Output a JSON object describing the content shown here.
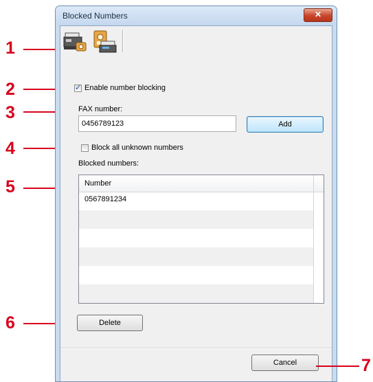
{
  "window": {
    "title": "Blocked Numbers",
    "close_label": "✕"
  },
  "toolbar": {
    "items": [
      {
        "icon": "fax-machine-icon"
      },
      {
        "icon": "fax-phonebook-icon"
      }
    ]
  },
  "enable_blocking": {
    "label": "Enable number blocking",
    "checked": true
  },
  "fax_number": {
    "label": "FAX number:",
    "value": "0456789123"
  },
  "add_button": {
    "label": "Add"
  },
  "block_unknown": {
    "label": "Block all unknown numbers",
    "checked": false
  },
  "blocked_numbers": {
    "label": "Blocked numbers:",
    "column_header": "Number",
    "rows": [
      "0567891234",
      "",
      "",
      "",
      "",
      ""
    ]
  },
  "delete_button": {
    "label": "Delete"
  },
  "cancel_button": {
    "label": "Cancel"
  },
  "callouts": [
    "1",
    "2",
    "3",
    "4",
    "5",
    "6",
    "7"
  ],
  "colors": {
    "callout": "#d8001c",
    "window_frame": "#c9dbef",
    "close_button": "#c8452a"
  }
}
